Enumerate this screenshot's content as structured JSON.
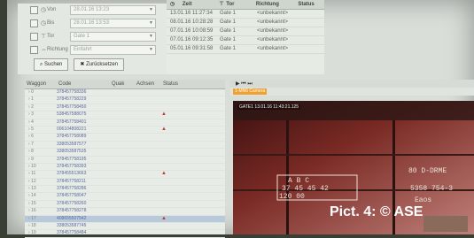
{
  "filter": {
    "from_label": "Von",
    "from_value": "28.01.16 13:23",
    "to_label": "Bis",
    "to_value": "28.01.16 13:53",
    "gate_label": "Tor",
    "gate_value": "Gate 1",
    "dir_label": "Richtung",
    "dir_value": "Einfahrt",
    "search_label": "Suchen",
    "reset_label": "Zurücksetzen"
  },
  "events": {
    "headers": [
      "Zeit",
      "Tor",
      "Richtung",
      "Status"
    ],
    "rows": [
      {
        "time": "13.01.16 11:27:34",
        "gate": "Gate 1",
        "dir": "<unbekannt>"
      },
      {
        "time": "08.01.16 10:28:28",
        "gate": "Gate 1",
        "dir": "<unbekannt>"
      },
      {
        "time": "07.01.16 10:08:59",
        "gate": "Gate 1",
        "dir": "<unbekannt>"
      },
      {
        "time": "07.01.16 09:12:35",
        "gate": "Gate 1",
        "dir": "<unbekannt>"
      },
      {
        "time": "05.01.16 09:31:58",
        "gate": "Gate 1",
        "dir": "<unbekannt>"
      }
    ]
  },
  "wagons": {
    "headers": [
      "Waggon",
      "Code",
      "Quak",
      "Achsen",
      "Status"
    ],
    "rows": [
      {
        "n": "0",
        "code": "378457758336",
        "s": ""
      },
      {
        "n": "1",
        "code": "378457758229",
        "s": ""
      },
      {
        "n": "2",
        "code": "378457758450",
        "s": ""
      },
      {
        "n": "3",
        "code": "538457588075",
        "s": "▲"
      },
      {
        "n": "4",
        "code": "378457758401",
        "s": ""
      },
      {
        "n": "5",
        "code": "006104808221",
        "s": "▲"
      },
      {
        "n": "6",
        "code": "378457758089",
        "s": ""
      },
      {
        "n": "7",
        "code": "338053587577",
        "s": ""
      },
      {
        "n": "8",
        "code": "338053587535",
        "s": ""
      },
      {
        "n": "9",
        "code": "378457758195",
        "s": ""
      },
      {
        "n": "10",
        "code": "378457758393",
        "s": ""
      },
      {
        "n": "11",
        "code": "378455513663",
        "s": "▲"
      },
      {
        "n": "12",
        "code": "378457758211",
        "s": ""
      },
      {
        "n": "13",
        "code": "378457758286",
        "s": ""
      },
      {
        "n": "14",
        "code": "378457758047",
        "s": ""
      },
      {
        "n": "15",
        "code": "378457758260",
        "s": ""
      },
      {
        "n": "16",
        "code": "378457758278",
        "s": ""
      },
      {
        "n": "17",
        "code": "408655507542",
        "s": "▲"
      },
      {
        "n": "18",
        "code": "338053587745",
        "s": ""
      },
      {
        "n": "19",
        "code": "378457758484",
        "s": ""
      }
    ]
  },
  "media": {
    "controls": "▶  ⏮  ⏭",
    "camera_tag": "1-MN6 Camera",
    "camera_label": "GATE1 13.01.16 11:43:21.125",
    "watermark": "Pict. 4: © ASE",
    "stencil1": "A  B  C",
    "stencil2": "37 45 45 42",
    "stencil3": "120   00",
    "stencil4": "80  D-DRME",
    "stencil5": "5358  754-3",
    "stencil6": "Eaos"
  }
}
